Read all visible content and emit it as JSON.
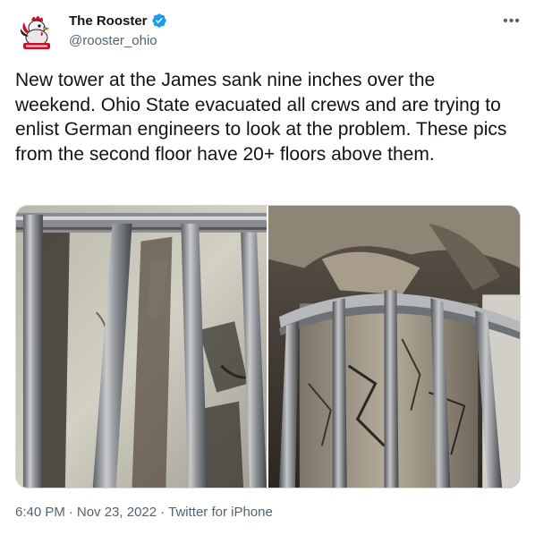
{
  "author": {
    "display_name": "The Rooster",
    "handle": "@rooster_ohio",
    "avatar_icon": "rooster-logo-icon",
    "verified_icon": "verified-badge-icon",
    "verified_color": "#1d9bf0"
  },
  "more_icon": "ellipsis-icon",
  "tweet": {
    "text": "New tower at the James sank nine inches over the weekend. Ohio State evacuated all crews and are trying to enlist German engineers to look at the problem. These pics from the second floor have 20+ floors above them."
  },
  "media": {
    "photo_count": 2
  },
  "meta": {
    "time": "6:40 PM",
    "date": "Nov 23, 2022",
    "separator": "·",
    "source": "Twitter for iPhone"
  },
  "colors": {
    "text_primary": "#0f1419",
    "text_secondary": "#536471",
    "border": "#cfd9de"
  }
}
